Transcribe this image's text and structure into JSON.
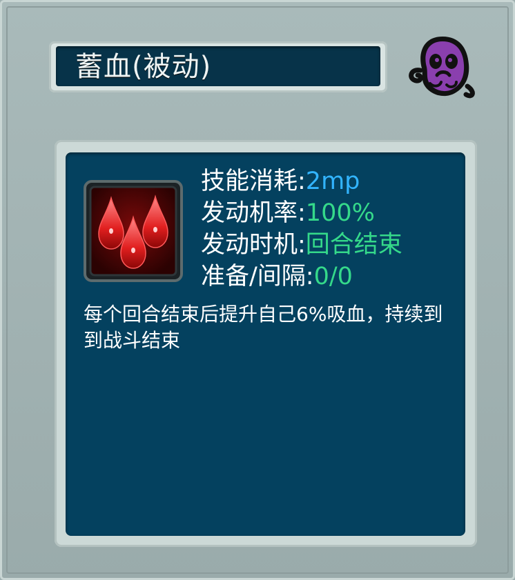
{
  "skill": {
    "title": "蓄血(被动)",
    "icon": "blood-drops-icon",
    "stats": [
      {
        "label": "技能消耗:",
        "value": "2mp",
        "color": "#32b4ff"
      },
      {
        "label": "发动机率:",
        "value": "100%",
        "color": "#35d98a"
      },
      {
        "label": "发动时机:",
        "value": "回合结束",
        "color": "#35d98a"
      },
      {
        "label": "准备/间隔:",
        "value": "0/0",
        "color": "#35d98a"
      }
    ],
    "description": "每个回合结束后提升自己6%吸血，持续到到战斗结束"
  },
  "badge": {
    "icon": "purple-skull-icon",
    "color": "#8a3fae"
  }
}
